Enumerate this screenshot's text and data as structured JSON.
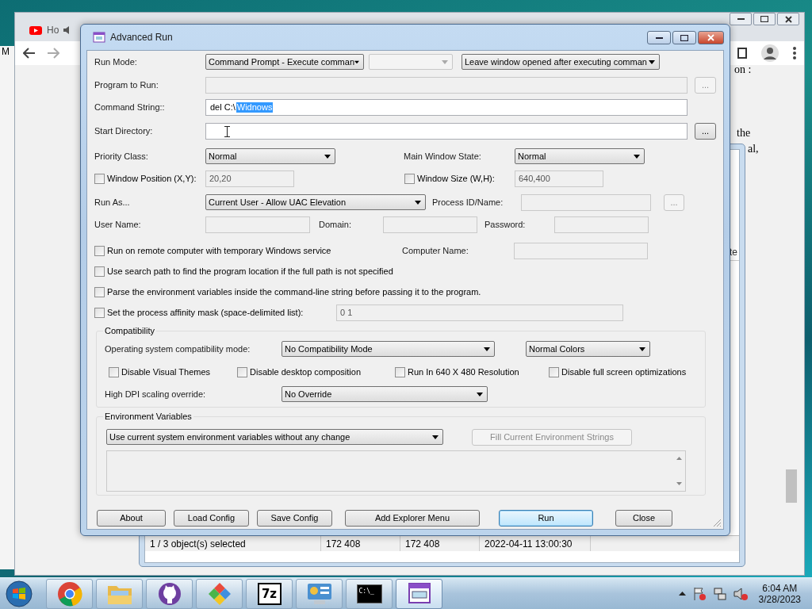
{
  "browser": {
    "tab_title": "Ho",
    "page_texts": [
      "on :",
      "the",
      "al,"
    ]
  },
  "side_window": {
    "text": "M"
  },
  "archive_window": {
    "column_header": "te",
    "status_bar": [
      "1 / 3 object(s) selected",
      "172 408",
      "172 408",
      "2022-04-11 13:00:30"
    ]
  },
  "dialog": {
    "title": "Advanced Run",
    "run_mode": {
      "label": "Run Mode:",
      "mode": "Command Prompt - Execute comman",
      "window_option": "Leave window opened after executing comman"
    },
    "program": {
      "label": "Program to Run:",
      "disabled": true,
      "browse": "...",
      "browse_disabled": true
    },
    "command": {
      "label": "Command String::",
      "value": "del C:\\",
      "selected_text": "Widnows"
    },
    "start_dir": {
      "label": "Start Directory:",
      "browse": "...",
      "browse_disabled": false
    },
    "priority": {
      "label": "Priority Class:",
      "value": "Normal"
    },
    "window_state": {
      "label": "Main Window State:",
      "value": "Normal"
    },
    "window_position": {
      "label": "Window Position (X,Y):",
      "checked": false,
      "value": "20,20"
    },
    "window_size": {
      "label": "Window Size (W,H):",
      "checked": false,
      "value": "640,400"
    },
    "run_as": {
      "label": "Run As...",
      "value": "Current User - Allow UAC Elevation"
    },
    "process": {
      "label": "Process ID/Name:",
      "browse": "...",
      "browse_disabled": true
    },
    "user_name": {
      "label": "User Name:"
    },
    "domain": {
      "label": "Domain:"
    },
    "password": {
      "label": "Password:"
    },
    "computer_name": {
      "label": "Computer Name:"
    },
    "options": [
      {
        "label": "Run on remote computer with temporary Windows service",
        "checked": false
      },
      {
        "label": "Use search path to find the program location if the full path is not specified",
        "checked": false
      },
      {
        "label": "Parse the environment variables inside the command-line string before passing it to the program.",
        "checked": false
      },
      {
        "label": "Set the process affinity mask (space-delimited list):",
        "checked": false
      }
    ],
    "affinity_value": "0 1",
    "compatibility": {
      "legend": "Compatibility",
      "mode_label": "Operating system compatibility mode:",
      "mode": "No Compatibility Mode",
      "colors": "Normal Colors",
      "checks": [
        {
          "label": "Disable Visual Themes",
          "checked": false
        },
        {
          "label": "Disable desktop composition",
          "checked": false
        },
        {
          "label": "Run In 640 X 480 Resolution",
          "checked": false
        },
        {
          "label": "Disable full screen optimizations",
          "checked": false
        }
      ],
      "dpi_label": "High DPI scaling override:",
      "dpi": "No Override"
    },
    "environment": {
      "legend": "Environment Variables",
      "mode": "Use current system environment variables without any change",
      "fill_button": "Fill Current Environment Strings",
      "fill_disabled": true
    },
    "buttons": [
      {
        "label": "About",
        "default": false
      },
      {
        "label": "Load Config",
        "default": false
      },
      {
        "label": "Save Config",
        "default": false
      },
      {
        "label": "Add Explorer Menu",
        "default": false
      },
      {
        "label": "Run",
        "default": true
      },
      {
        "label": "Close",
        "default": false
      }
    ]
  },
  "taskbar": {
    "apps": [
      {
        "kind": "chrome"
      },
      {
        "kind": "folder"
      },
      {
        "kind": "github"
      },
      {
        "kind": "diamond"
      },
      {
        "kind": "archiver",
        "label": "7z"
      },
      {
        "kind": "panel"
      },
      {
        "kind": "console",
        "label": "C:\\_"
      },
      {
        "kind": "runner",
        "active": true
      }
    ],
    "clock": {
      "time": "6:04 AM",
      "date": "3/28/2023"
    }
  }
}
